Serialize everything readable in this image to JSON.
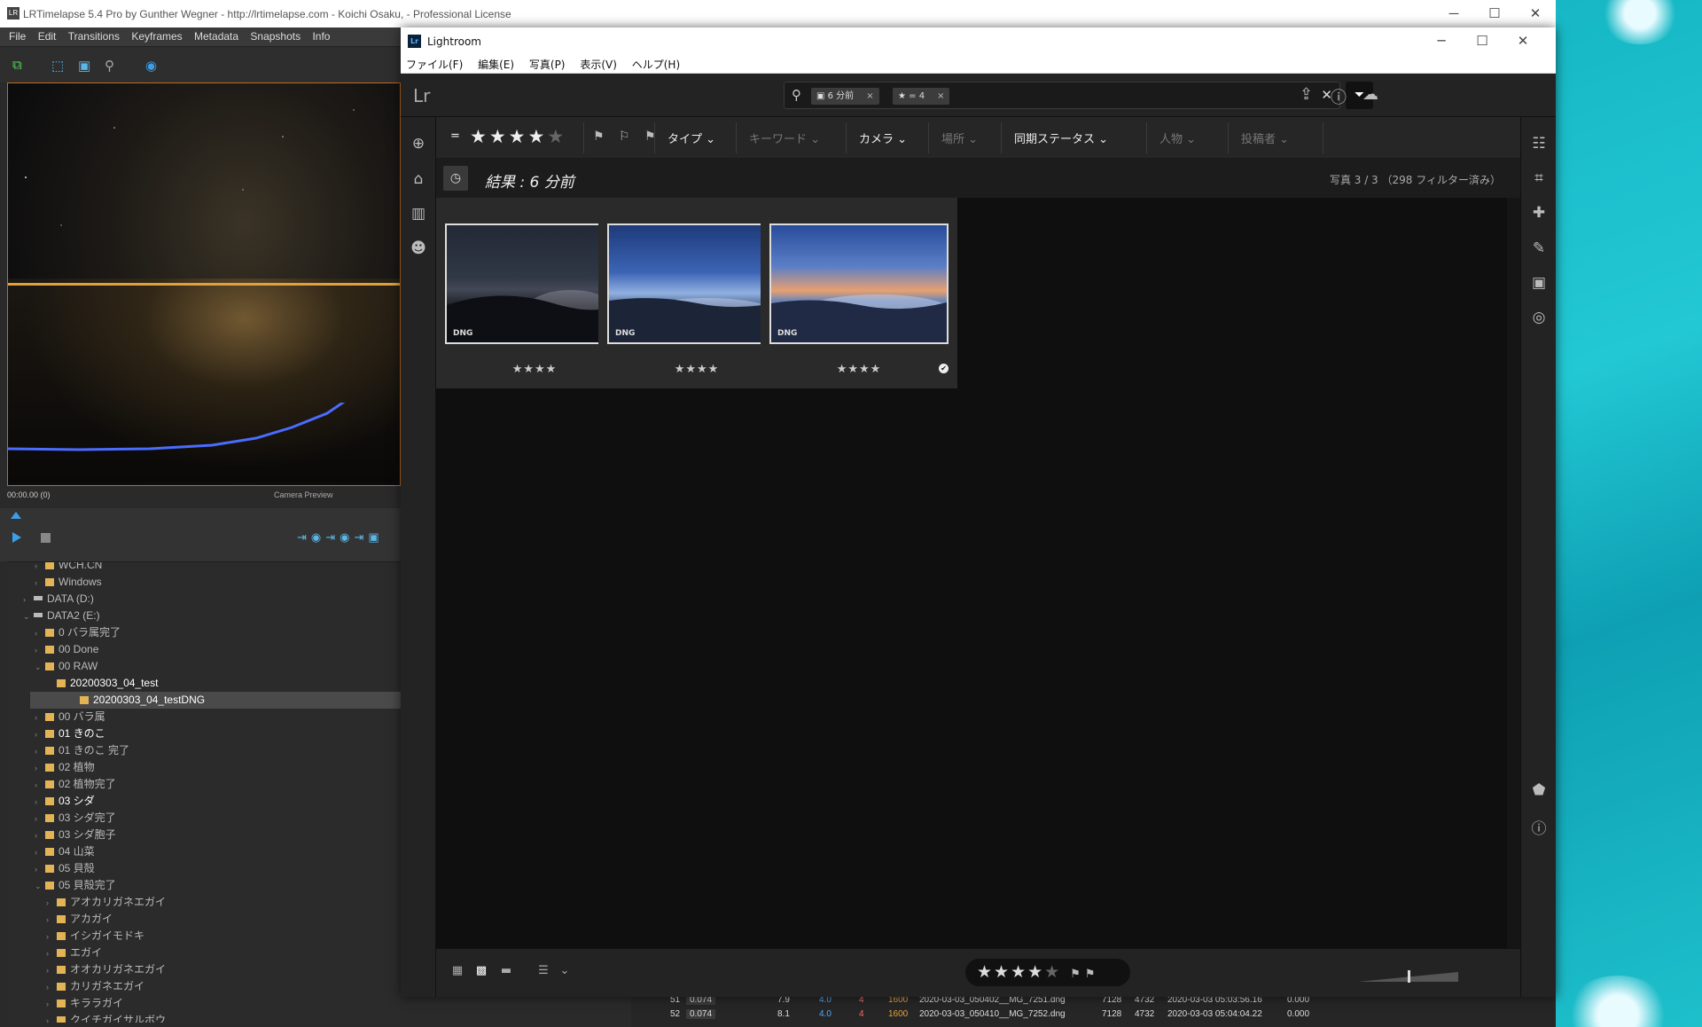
{
  "desktop": {
    "accent": "#1ec0cc"
  },
  "lrt": {
    "title": "LRTimelapse 5.4 Pro by Gunther Wegner - http://lrtimelapse.com - Koichi Osaku,  - Professional License",
    "window_controls": {
      "minimize": "─",
      "maximize": "☐",
      "close": "✕"
    },
    "menu": [
      "File",
      "Edit",
      "Transitions",
      "Keyframes",
      "Metadata",
      "Snapshots",
      "Info"
    ],
    "preview": {
      "timecode": "00:00.00 (0)",
      "label": "Camera Preview"
    },
    "tree": [
      {
        "label": "WCH.CN",
        "indent": 1,
        "arrow": "›"
      },
      {
        "label": "Windows",
        "indent": 1,
        "arrow": "›"
      },
      {
        "label": "DATA (D:)",
        "indent": 0,
        "arrow": "›",
        "drive": true
      },
      {
        "label": "DATA2 (E:)",
        "indent": 0,
        "arrow": "⌄",
        "drive": true
      },
      {
        "label": "0  バラ属完了",
        "indent": 1,
        "arrow": "›"
      },
      {
        "label": "00 Done",
        "indent": 1,
        "arrow": "›"
      },
      {
        "label": "00 RAW",
        "indent": 1,
        "arrow": "⌄"
      },
      {
        "label": "20200303_04_test",
        "indent": 2,
        "arrow": "",
        "bright": true
      },
      {
        "label": "20200303_04_testDNG",
        "indent": 2,
        "arrow": "",
        "bright": true,
        "selected": true
      },
      {
        "label": "00 バラ属",
        "indent": 1,
        "arrow": "›"
      },
      {
        "label": "01 きのこ",
        "indent": 1,
        "arrow": "›",
        "bright": true
      },
      {
        "label": "01 きのこ 完了",
        "indent": 1,
        "arrow": "›"
      },
      {
        "label": "02 植物",
        "indent": 1,
        "arrow": "›"
      },
      {
        "label": "02 植物完了",
        "indent": 1,
        "arrow": "›"
      },
      {
        "label": "03 シダ",
        "indent": 1,
        "arrow": "›",
        "bright": true
      },
      {
        "label": "03 シダ完了",
        "indent": 1,
        "arrow": "›"
      },
      {
        "label": "03 シダ胞子",
        "indent": 1,
        "arrow": "›"
      },
      {
        "label": "04 山菜",
        "indent": 1,
        "arrow": "›"
      },
      {
        "label": "05 貝殻",
        "indent": 1,
        "arrow": "›"
      },
      {
        "label": "05 貝殻完了",
        "indent": 1,
        "arrow": "⌄"
      },
      {
        "label": "アオカリガネエガイ",
        "indent": 2,
        "arrow": "›"
      },
      {
        "label": "アカガイ",
        "indent": 2,
        "arrow": "›"
      },
      {
        "label": "イシガイモドキ",
        "indent": 2,
        "arrow": "›"
      },
      {
        "label": "エガイ",
        "indent": 2,
        "arrow": "›"
      },
      {
        "label": "オオカリガネエガイ",
        "indent": 2,
        "arrow": "›"
      },
      {
        "label": "カリガネエガイ",
        "indent": 2,
        "arrow": "›"
      },
      {
        "label": "キララガイ",
        "indent": 2,
        "arrow": "›"
      },
      {
        "label": "クイチガイサルボウ",
        "indent": 2,
        "arrow": "›"
      }
    ],
    "table_rows": [
      {
        "num": "51",
        "c1": "0.074",
        "c2": "7.9",
        "c3": "4.0",
        "c4": "4",
        "iso": "1600",
        "file": "2020-03-03_050402__MG_7251.dng",
        "w": "7128",
        "h": "4732",
        "date": "2020-03-03 05:03:56.16",
        "v": "0.000"
      },
      {
        "num": "52",
        "c1": "0.074",
        "c2": "8.1",
        "c3": "4.0",
        "c4": "4",
        "iso": "1600",
        "file": "2020-03-03_050410__MG_7252.dng",
        "w": "7128",
        "h": "4732",
        "date": "2020-03-03 05:04:04.22",
        "v": "0.000"
      }
    ]
  },
  "lr": {
    "title": "Lightroom",
    "logo": "Lr",
    "brand": "Lr",
    "menu": [
      "ファイル(F)",
      "編集(E)",
      "写真(P)",
      "表示(V)",
      "ヘルプ(H)"
    ],
    "search": {
      "chip_date": "6 分前",
      "chip_rating": "= 4",
      "chip_x": "×",
      "clear": "✕"
    },
    "filterbar": {
      "rating_op": "=",
      "stars_on": "★★★★",
      "stars_off": "★",
      "flags": "⚑ ⚐ ⚑",
      "items": [
        {
          "label": "タイプ ⌄",
          "dim": false
        },
        {
          "label": "キーワード ⌄",
          "dim": true
        },
        {
          "label": "カメラ ⌄",
          "dim": false
        },
        {
          "label": "場所 ⌄",
          "dim": true
        },
        {
          "label": "同期ステータス ⌄",
          "dim": false
        },
        {
          "label": "人物 ⌄",
          "dim": true
        },
        {
          "label": "投稿者 ⌄",
          "dim": true
        }
      ]
    },
    "result": {
      "title": "結果 : 6 分前",
      "count": "写真 3 / 3  （298 フィルター済み）"
    },
    "photos": [
      {
        "badge": "DNG",
        "rating": "★★★★",
        "check": "✔",
        "style": "night"
      },
      {
        "badge": "DNG",
        "rating": "★★★★",
        "check": "✔",
        "style": "dawn"
      },
      {
        "badge": "DNG",
        "rating": "★★★★",
        "check": "✔",
        "style": "sunrise"
      }
    ],
    "bottom": {
      "stars_on": "★★★★",
      "stars_off": "★",
      "flags": "⚑⚑"
    }
  }
}
